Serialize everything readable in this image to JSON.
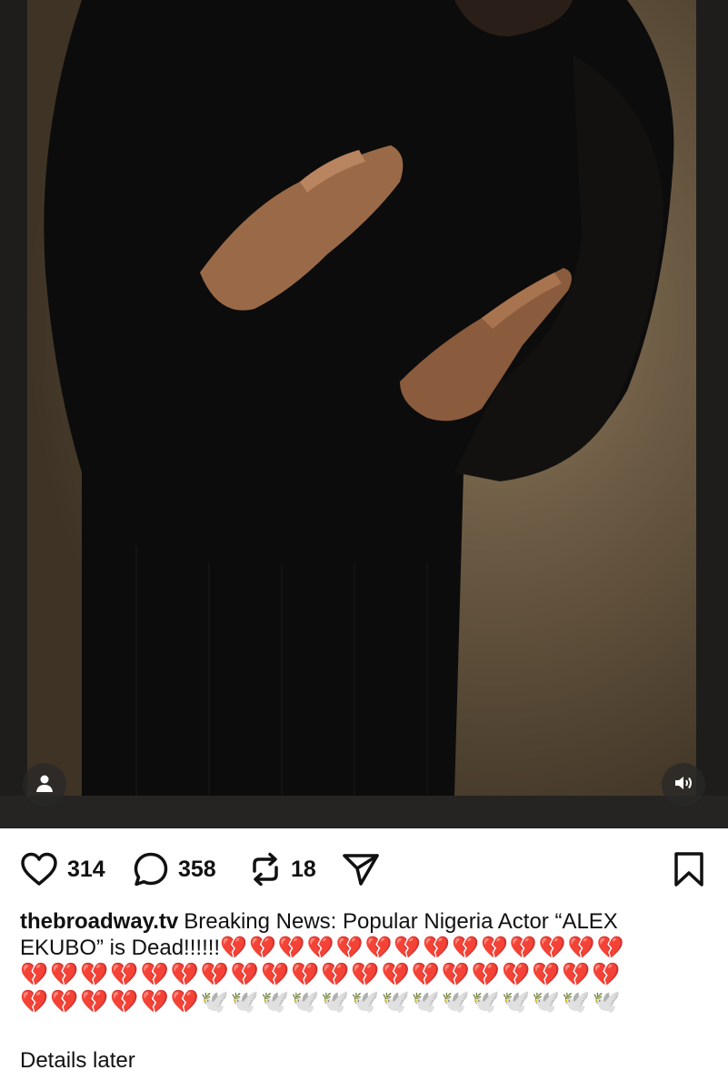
{
  "post": {
    "media": {
      "user_tag_icon": "person-icon",
      "audio_icon": "speaker-icon"
    },
    "actions": {
      "likes": "314",
      "comments": "358",
      "reposts": "18",
      "like_icon": "heart-icon",
      "comment_icon": "speech-bubble-icon",
      "repost_icon": "repost-arrows-icon",
      "share_icon": "paper-plane-icon",
      "save_icon": "bookmark-icon"
    },
    "caption": {
      "username": "thebroadway.tv",
      "text_line1": "Breaking News:  Popular Nigeria Actor “ALEX",
      "text_line2": "EKUBO”  is Dead!!!!!!",
      "emojis_line2": "💔💔💔💔💔💔💔💔💔💔💔💔💔💔",
      "emojis_line3": "💔💔💔💔💔💔💔💔💔💔💔💔💔💔💔💔💔💔💔💔",
      "emojis_line4_hearts": "💔💔💔💔💔💔",
      "emojis_line4_doves": "🕊️🕊️🕊️🕊️🕊️🕊️🕊️🕊️🕊️🕊️🕊️🕊️🕊️🕊️",
      "details": "Details later"
    },
    "colors": {
      "broken_heart": "#d81f1f",
      "icon": "#111111"
    }
  }
}
